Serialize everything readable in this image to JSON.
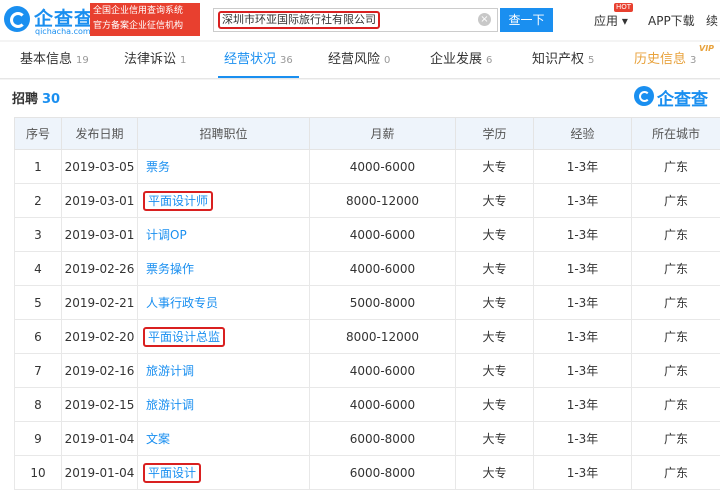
{
  "header": {
    "logo_text": "企查查",
    "logo_sub": "qichacha.com",
    "badge_line1": "全国企业信用查询系统",
    "badge_line2": "官方备案企业征信机构",
    "search_value": "深圳市环亚国际旅行社有限公司",
    "search_button": "查一下",
    "nav_app": "应用",
    "hot_label": "HOT",
    "nav_download": "APP下载",
    "nav_more": "续"
  },
  "tabs": [
    {
      "label": "基本信息",
      "count": "19"
    },
    {
      "label": "法律诉讼",
      "count": "1"
    },
    {
      "label": "经营状况",
      "count": "36"
    },
    {
      "label": "经营风险",
      "count": "0"
    },
    {
      "label": "企业发展",
      "count": "6"
    },
    {
      "label": "知识产权",
      "count": "5"
    },
    {
      "label": "历史信息",
      "count": "3"
    }
  ],
  "vip_label": "VIP",
  "section": {
    "title": "招聘",
    "count": "30",
    "watermark": "企查查"
  },
  "table": {
    "headers": [
      "序号",
      "发布日期",
      "招聘职位",
      "月薪",
      "学历",
      "经验",
      "所在城市"
    ],
    "rows": [
      {
        "no": "1",
        "date": "2019-03-05",
        "job": "票务",
        "salary": "4000-6000",
        "edu": "大专",
        "exp": "1-3年",
        "city": "广东",
        "highlight": false
      },
      {
        "no": "2",
        "date": "2019-03-01",
        "job": "平面设计师",
        "salary": "8000-12000",
        "edu": "大专",
        "exp": "1-3年",
        "city": "广东",
        "highlight": true
      },
      {
        "no": "3",
        "date": "2019-03-01",
        "job": "计调OP",
        "salary": "4000-6000",
        "edu": "大专",
        "exp": "1-3年",
        "city": "广东",
        "highlight": false
      },
      {
        "no": "4",
        "date": "2019-02-26",
        "job": "票务操作",
        "salary": "4000-6000",
        "edu": "大专",
        "exp": "1-3年",
        "city": "广东",
        "highlight": false
      },
      {
        "no": "5",
        "date": "2019-02-21",
        "job": "人事行政专员",
        "salary": "5000-8000",
        "edu": "大专",
        "exp": "1-3年",
        "city": "广东",
        "highlight": false
      },
      {
        "no": "6",
        "date": "2019-02-20",
        "job": "平面设计总监",
        "salary": "8000-12000",
        "edu": "大专",
        "exp": "1-3年",
        "city": "广东",
        "highlight": true
      },
      {
        "no": "7",
        "date": "2019-02-16",
        "job": "旅游计调",
        "salary": "4000-6000",
        "edu": "大专",
        "exp": "1-3年",
        "city": "广东",
        "highlight": false
      },
      {
        "no": "8",
        "date": "2019-02-15",
        "job": "旅游计调",
        "salary": "4000-6000",
        "edu": "大专",
        "exp": "1-3年",
        "city": "广东",
        "highlight": false
      },
      {
        "no": "9",
        "date": "2019-01-04",
        "job": "文案",
        "salary": "6000-8000",
        "edu": "大专",
        "exp": "1-3年",
        "city": "广东",
        "highlight": false
      },
      {
        "no": "10",
        "date": "2019-01-04",
        "job": "平面设计",
        "salary": "6000-8000",
        "edu": "大专",
        "exp": "1-3年",
        "city": "广东",
        "highlight": true
      }
    ]
  },
  "colors": {
    "brand": "#1a8ff0",
    "highlight_box": "#d92020",
    "history_tab": "#e8a23c"
  }
}
